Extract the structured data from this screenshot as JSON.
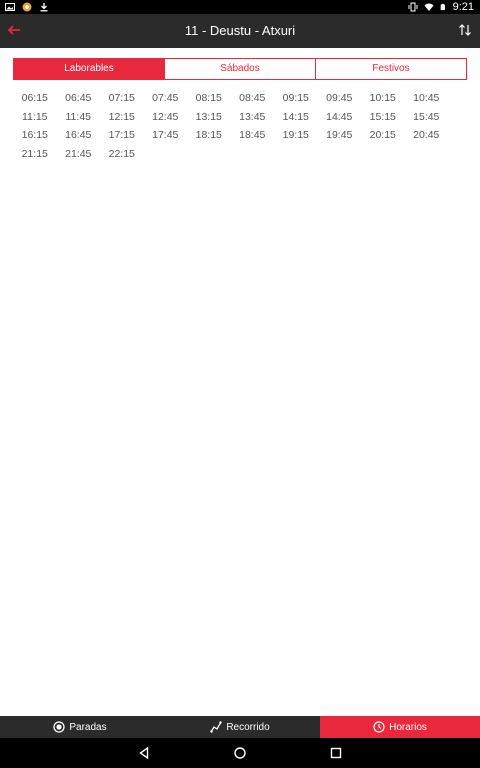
{
  "status_bar": {
    "time": "9:21",
    "left_icons": [
      "image-icon",
      "notification-icon",
      "download-icon"
    ],
    "right_icons": [
      "vibrate-icon",
      "wifi-icon",
      "battery-icon"
    ]
  },
  "app_bar": {
    "title": "11 - Deustu - Atxuri",
    "back_icon": "arrow-left-icon",
    "swap_icon": "swap-vertical-icon"
  },
  "tabs": [
    {
      "label": "Laborables",
      "active": true
    },
    {
      "label": "Sábados",
      "active": false
    },
    {
      "label": "Festivos",
      "active": false
    }
  ],
  "times": [
    "06:15",
    "06:45",
    "07:15",
    "07:45",
    "08:15",
    "08:45",
    "09:15",
    "09:45",
    "10:15",
    "10:45",
    "11:15",
    "11:45",
    "12:15",
    "12:45",
    "13:15",
    "13:45",
    "14:15",
    "14:45",
    "15:15",
    "15:45",
    "16:15",
    "16:45",
    "17:15",
    "17:45",
    "18:15",
    "18:45",
    "19:15",
    "19:45",
    "20:15",
    "20:45",
    "21:15",
    "21:45",
    "22:15"
  ],
  "bottom_nav": [
    {
      "label": "Paradas",
      "icon": "stop-circle-icon",
      "active": false
    },
    {
      "label": "Recorrido",
      "icon": "route-icon",
      "active": false
    },
    {
      "label": "Horarios",
      "icon": "clock-icon",
      "active": true
    }
  ],
  "colors": {
    "accent": "#e8283c",
    "appbar": "#2b2b2b",
    "statusbar": "#000000"
  }
}
